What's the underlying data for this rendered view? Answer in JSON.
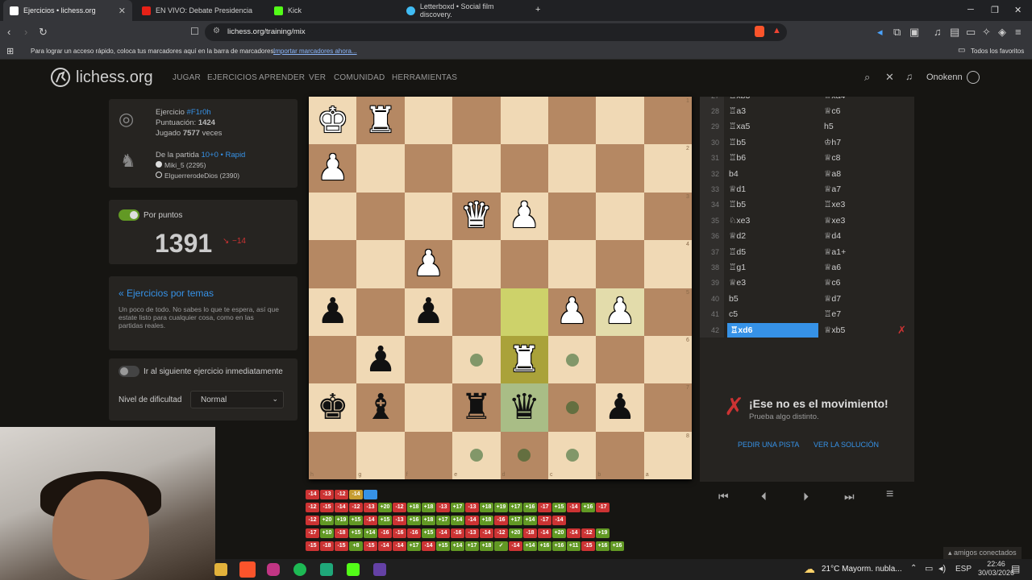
{
  "browser": {
    "tabs": [
      {
        "title": "Ejercicios • lichess.org",
        "active": true
      },
      {
        "title": "EN VIVO: Debate Presidencia"
      },
      {
        "title": "Kick"
      },
      {
        "title": "Letterboxd • Social film discovery."
      }
    ],
    "url": "lichess.org/training/mix",
    "bookmarks_hint": "Para lograr un acceso rápido, coloca tus marcadores aquí en la barra de marcadores.",
    "bookmarks_import": "Importar marcadores ahora...",
    "bookmarks_all": "Todos los favoritos"
  },
  "site": {
    "logo": "lichess.org",
    "nav": [
      "JUGAR",
      "EJERCICIOS",
      "APRENDER",
      "VER",
      "COMUNIDAD",
      "HERRAMIENTAS"
    ],
    "user": "Onokenn"
  },
  "puzzle": {
    "label": "Ejercicio",
    "id": "#F1r0h",
    "rating_label": "Puntuación:",
    "rating": "1424",
    "played_label": "Jugado",
    "played": "7577",
    "played_suffix": "veces",
    "game_label": "De la partida",
    "game_link": "10+0 • Rapid",
    "player_white": "Miki_5 (2295)",
    "player_black": "ElguerrerodeDios (2390)"
  },
  "score": {
    "toggle_label": "Por puntos",
    "rating": "1391",
    "delta": "−14"
  },
  "themes": {
    "link": "« Ejercicios por temas",
    "desc": "Un poco de todo. No sabes lo que te espera, así que estate listo para cualquier cosa, como en las partidas reales."
  },
  "settings": {
    "next_label": "Ir al siguiente ejercicio inmediatamente",
    "difficulty_label": "Nivel de dificultad",
    "difficulty_value": "Normal"
  },
  "board": {
    "files": [
      "h",
      "g",
      "f",
      "e",
      "d",
      "c",
      "b",
      "a"
    ],
    "ranks": [
      "1",
      "2",
      "3",
      "4",
      "5",
      "6",
      "7",
      "8"
    ]
  },
  "moves": [
    {
      "n": "27",
      "w": "♖xb3",
      "b": "♕xa4"
    },
    {
      "n": "28",
      "w": "♖a3",
      "b": "♕c6"
    },
    {
      "n": "29",
      "w": "♖xa5",
      "b": "h5"
    },
    {
      "n": "30",
      "w": "♖b5",
      "b": "♔h7"
    },
    {
      "n": "31",
      "w": "♖b6",
      "b": "♕c8"
    },
    {
      "n": "32",
      "w": "b4",
      "b": "♕a8"
    },
    {
      "n": "33",
      "w": "♕d1",
      "b": "♕a7"
    },
    {
      "n": "34",
      "w": "♖b5",
      "b": "♖xe3"
    },
    {
      "n": "35",
      "w": "♘xe3",
      "b": "♕xe3"
    },
    {
      "n": "36",
      "w": "♕d2",
      "b": "♕d4"
    },
    {
      "n": "37",
      "w": "♖d5",
      "b": "♕a1+"
    },
    {
      "n": "38",
      "w": "♖g1",
      "b": "♕a6"
    },
    {
      "n": "39",
      "w": "♕e3",
      "b": "♕c6"
    },
    {
      "n": "40",
      "w": "b5",
      "b": "♕d7"
    },
    {
      "n": "41",
      "w": "c5",
      "b": "♖e7"
    },
    {
      "n": "42",
      "w": "♖xd6",
      "b": "♕xb5"
    }
  ],
  "feedback": {
    "title": "¡Ese no es el movimiento!",
    "sub": "Prueba algo distinto.",
    "hint": "PEDIR UNA PISTA",
    "solution": "VER LA SOLUCIÓN"
  },
  "history_chips": [
    [
      "-14",
      "-13",
      "-12",
      "-14",
      ""
    ],
    [
      "-12",
      "-15",
      "-14",
      "-12",
      "-13",
      "+20",
      "-12",
      "+18",
      "+18",
      "-13",
      "+17",
      "-13",
      "+18",
      "+19",
      "+17",
      "+16",
      "-17",
      "+15",
      "-14",
      "+16",
      "-17"
    ],
    [
      "-12",
      "+20",
      "+19",
      "+15",
      "-14",
      "+15",
      "-13",
      "+16",
      "+18",
      "+17",
      "+14",
      "-14",
      "+18",
      "-16",
      "+17",
      "+14",
      "-17",
      "-14"
    ],
    [
      "-17",
      "+10",
      "-18",
      "+15",
      "+14",
      "-16",
      "-16",
      "-16",
      "+15",
      "-14",
      "-16",
      "-13",
      "-14",
      "-12",
      "+20",
      "-18",
      "-14",
      "+20",
      "-14",
      "-12",
      "+19"
    ],
    [
      "-15",
      "-18",
      "-15",
      "+8",
      "-15",
      "-14",
      "-14",
      "+17",
      "-14",
      "+15",
      "+14",
      "+17",
      "+18",
      "✓",
      "-14",
      "+14",
      "+16",
      "+16",
      "+11",
      "-15",
      "+16",
      "+16"
    ]
  ],
  "colors": {
    "accent": "#3692e7",
    "green": "#629924",
    "red": "#cc3333",
    "bg": "#161512",
    "card": "#262421"
  },
  "taskbar": {
    "weather": "21°C  Mayorm. nubla...",
    "lang": "ESP",
    "time": "22:46",
    "date": "30/03/2026",
    "friends": "amigos conectados"
  }
}
